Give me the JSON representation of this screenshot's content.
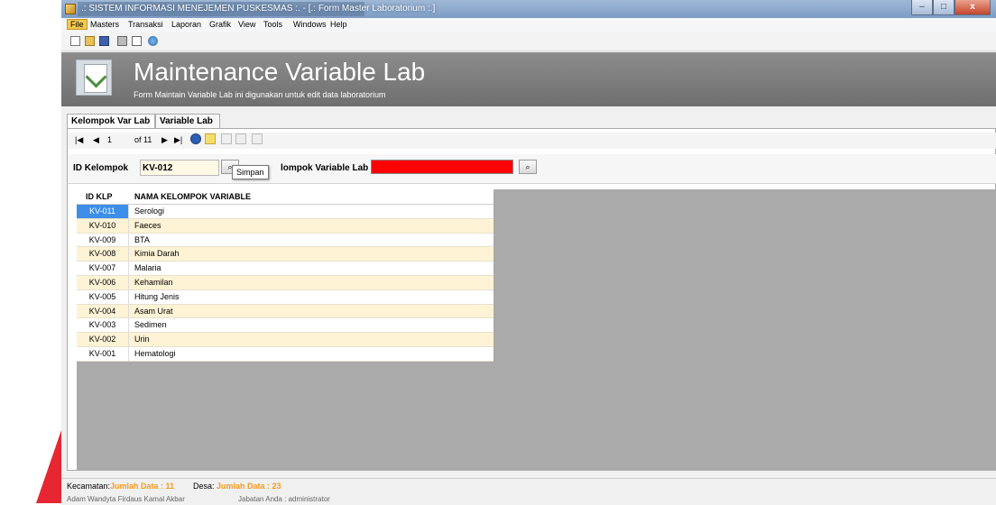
{
  "window": {
    "title": ".: SISTEM INFORMASI MENEJEMEN PUSKESMAS :. - [.: Form Master Laboratorium :.]",
    "minimize": "–",
    "maximize": "□",
    "close": "x"
  },
  "menu": {
    "items": [
      "File",
      "Masters",
      "Transaksi",
      "Laporan",
      "Grafik",
      "View",
      "Tools",
      "Windows",
      "Help"
    ]
  },
  "header": {
    "title": "Maintenance Variable Lab",
    "subtitle": "Form Maintain Variable Lab ini digunakan untuk edit data laboratorium"
  },
  "tabs": [
    "Kelompok Var Lab",
    "Variable Lab"
  ],
  "navigator": {
    "first": "|◀",
    "prev": "◀",
    "position": "1",
    "of_label": "of 11",
    "next": "▶",
    "last": "▶|"
  },
  "search": {
    "id_label": "ID Kelompok",
    "id_value": "KV-012",
    "name_label_partial": "lompok Variable Lab",
    "tooltip": "Simpan"
  },
  "grid": {
    "columns": [
      "ID KLP",
      "NAMA KELOMPOK VARIABLE"
    ],
    "rows": [
      {
        "id": "KV-011",
        "name": "Serologi"
      },
      {
        "id": "KV-010",
        "name": "Faeces"
      },
      {
        "id": "KV-009",
        "name": "BTA"
      },
      {
        "id": "KV-008",
        "name": "Kimia Darah"
      },
      {
        "id": "KV-007",
        "name": "Malaria"
      },
      {
        "id": "KV-006",
        "name": "Kehamilan"
      },
      {
        "id": "KV-005",
        "name": "Hitung Jenis"
      },
      {
        "id": "KV-004",
        "name": "Asam Urat"
      },
      {
        "id": "KV-003",
        "name": "Sedimen"
      },
      {
        "id": "KV-002",
        "name": "Urin"
      },
      {
        "id": "KV-001",
        "name": "Hematologi"
      }
    ]
  },
  "status": {
    "kecamatan_label": "Kecamatan:",
    "kecamatan_value": "Jumlah Data : 11",
    "desa_label": "Desa:",
    "desa_value": "Jumlah Data : 23",
    "user_text": "Adam Wandyta Firdaus Kamal Akbar",
    "role_text": "Jabatan Anda : administrator"
  },
  "colors": {
    "header_bg": "#7f7f7f",
    "alt_row": "#fff3d6",
    "selected": "#3d8ee8",
    "status_accent": "#f39a1e",
    "name_field": "#ff0000"
  }
}
